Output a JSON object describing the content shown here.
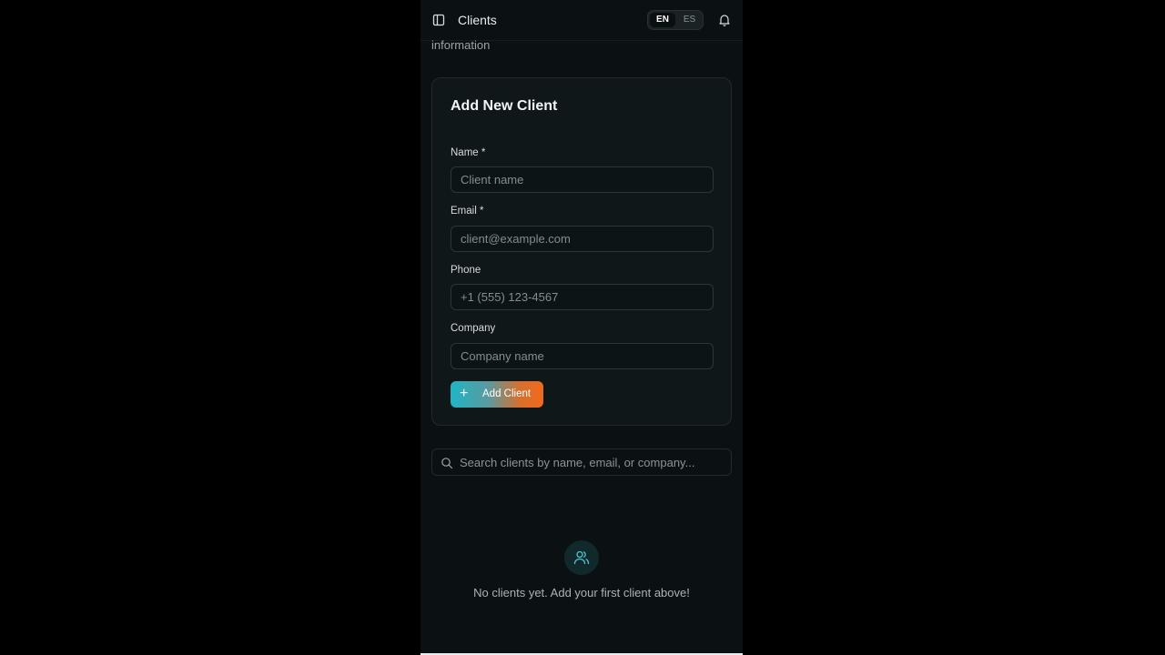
{
  "header": {
    "title": "Clients",
    "languages": [
      "EN",
      "ES"
    ],
    "active_language": "EN"
  },
  "subtitle_fragment": "information",
  "form": {
    "title": "Add New Client",
    "fields": [
      {
        "label": "Name *",
        "placeholder": "Client name",
        "value": ""
      },
      {
        "label": "Email *",
        "placeholder": "client@example.com",
        "value": ""
      },
      {
        "label": "Phone",
        "placeholder": "+1 (555) 123-4567",
        "value": ""
      },
      {
        "label": "Company",
        "placeholder": "Company name",
        "value": ""
      }
    ],
    "submit_label": "Add Client",
    "submit_icon": "+"
  },
  "search": {
    "placeholder": "Search clients by name, email, or company...",
    "value": ""
  },
  "empty_state": {
    "icon": "users-icon",
    "message": "No clients yet. Add your first client above!"
  },
  "colors": {
    "background": "#0b1112",
    "accent_start": "#1fb5c4",
    "accent_end": "#f06a1c"
  }
}
